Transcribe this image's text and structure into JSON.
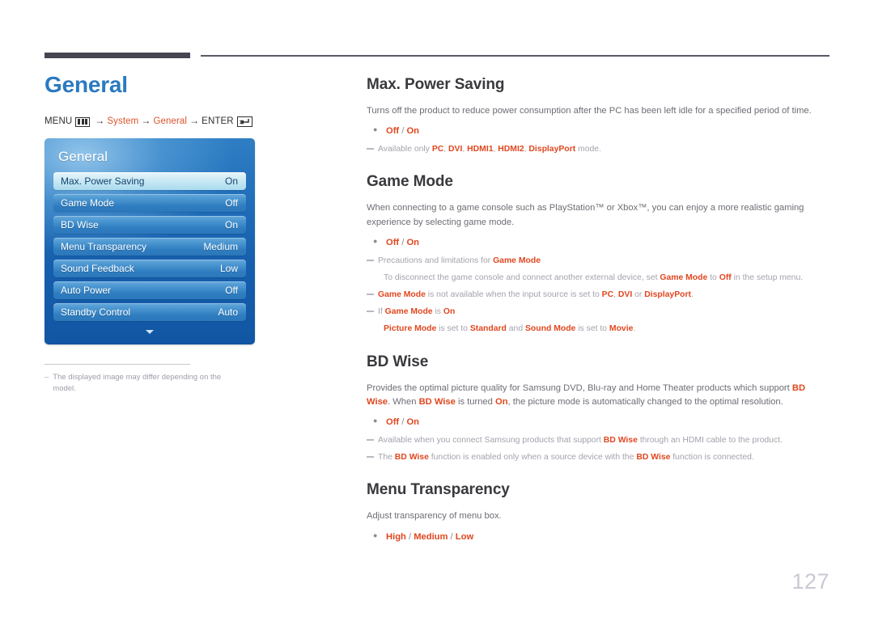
{
  "page": {
    "title": "General",
    "number": "127"
  },
  "breadcrumb": {
    "menu_label": "MENU",
    "menu_icon": "menu-bars-icon",
    "arrow": "→",
    "step1": "System",
    "step2": "General",
    "enter_label": "ENTER",
    "enter_icon": "enter-key-icon"
  },
  "osd": {
    "title": "General",
    "rows": [
      {
        "label": "Max. Power Saving",
        "value": "On",
        "selected": true
      },
      {
        "label": "Game Mode",
        "value": "Off",
        "selected": false
      },
      {
        "label": "BD Wise",
        "value": "On",
        "selected": false
      },
      {
        "label": "Menu Transparency",
        "value": "Medium",
        "selected": false
      },
      {
        "label": "Sound Feedback",
        "value": "Low",
        "selected": false
      },
      {
        "label": "Auto Power",
        "value": "Off",
        "selected": false
      },
      {
        "label": "Standby Control",
        "value": "Auto",
        "selected": false
      }
    ],
    "more_icon": "chevron-down-icon",
    "footnote_dash": "–",
    "footnote": "The displayed image may differ depending on the model."
  },
  "sections": {
    "max_power_saving": {
      "title": "Max. Power Saving",
      "desc": "Turns off the product to reduce power consumption after the PC has been left idle for a specified period of time.",
      "options": {
        "a": "Off",
        "sep": " / ",
        "b": "On"
      },
      "note1_pre": "Available only ",
      "note1_em1": "PC",
      "note1_mid1": ", ",
      "note1_em2": "DVI",
      "note1_mid2": ", ",
      "note1_em3": "HDMI1",
      "note1_mid3": ", ",
      "note1_em4": "HDMI2",
      "note1_mid4": ", ",
      "note1_em5": "DisplayPort",
      "note1_post": " mode."
    },
    "game_mode": {
      "title": "Game Mode",
      "desc": "When connecting to a game console such as PlayStation™ or Xbox™, you can enjoy a more realistic gaming experience by selecting game mode.",
      "options": {
        "a": "Off",
        "sep": " / ",
        "b": "On"
      },
      "note1_pre": "Precautions and limitations for ",
      "note1_em": "Game Mode",
      "note1_sub_pre": "To disconnect the game console and connect another external device, set ",
      "note1_sub_em1": "Game Mode",
      "note1_sub_mid": " to ",
      "note1_sub_em2": "Off",
      "note1_sub_post": " in the setup menu.",
      "note2_em1": "Game Mode",
      "note2_mid1": " is not available when the input source is set to ",
      "note2_em2": "PC",
      "note2_mid2": ", ",
      "note2_em3": "DVI",
      "note2_mid3": " or ",
      "note2_em4": "DisplayPort",
      "note2_post": ".",
      "note3_pre": "If ",
      "note3_em1": "Game Mode",
      "note3_mid": " is ",
      "note3_em2": "On",
      "note3_sub_em1": "Picture Mode",
      "note3_sub_mid1": " is set to ",
      "note3_sub_em2": "Standard",
      "note3_sub_mid2": " and ",
      "note3_sub_em3": "Sound Mode",
      "note3_sub_mid3": " is set to ",
      "note3_sub_em4": "Movie",
      "note3_sub_post": "."
    },
    "bd_wise": {
      "title": "BD Wise",
      "desc_pre": "Provides the optimal picture quality for Samsung DVD, Blu-ray and Home Theater products which support ",
      "desc_em1": "BD Wise",
      "desc_mid1": ". When ",
      "desc_em2": "BD Wise",
      "desc_mid2": " is turned ",
      "desc_em3": "On",
      "desc_post": ", the picture mode is automatically changed to the optimal resolution.",
      "options": {
        "a": "Off",
        "sep": " / ",
        "b": "On"
      },
      "note1_pre": "Available when you connect Samsung products that support ",
      "note1_em": "BD Wise",
      "note1_post": " through an HDMI cable to the product.",
      "note2_pre": "The ",
      "note2_em1": "BD Wise",
      "note2_mid": " function is enabled only when a source device with the ",
      "note2_em2": "BD Wise",
      "note2_post": " function is connected."
    },
    "menu_transparency": {
      "title": "Menu Transparency",
      "desc": "Adjust transparency of menu box.",
      "options": {
        "a": "High",
        "sep1": " / ",
        "b": "Medium",
        "sep2": " / ",
        "c": "Low"
      }
    }
  },
  "colors": {
    "title_blue": "#2a7ac0",
    "accent_orange": "#e0471f",
    "heading_dark": "#39393d",
    "body_gray": "#6d6d75",
    "note_gray": "#a3a3ad",
    "rule_dark": "#454553",
    "page_num_gray": "#c9c9d4"
  }
}
